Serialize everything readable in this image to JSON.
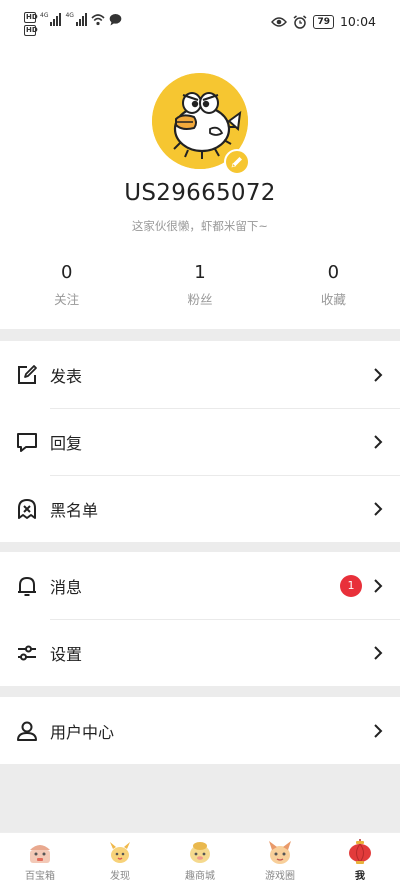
{
  "status_bar": {
    "hd1": "HD",
    "hd2": "HD",
    "net1": "4G",
    "net2": "4G",
    "battery": "79",
    "time": "10:04"
  },
  "profile": {
    "username": "US29665072",
    "bio": "这家伙很懒，虾都米留下~",
    "stats": [
      {
        "value": "0",
        "label": "关注"
      },
      {
        "value": "1",
        "label": "粉丝"
      },
      {
        "value": "0",
        "label": "收藏"
      }
    ]
  },
  "menu": {
    "group1": [
      {
        "label": "发表",
        "icon": "edit-icon"
      },
      {
        "label": "回复",
        "icon": "comment-icon"
      },
      {
        "label": "黑名单",
        "icon": "blacklist-icon"
      }
    ],
    "group2": [
      {
        "label": "消息",
        "icon": "bell-icon",
        "badge": "1"
      },
      {
        "label": "设置",
        "icon": "settings-sliders-icon"
      }
    ],
    "group3": [
      {
        "label": "用户中心",
        "icon": "user-icon"
      }
    ]
  },
  "tabbar": [
    {
      "label": "百宝箱",
      "icon": "treasure-box-icon",
      "active": false
    },
    {
      "label": "发现",
      "icon": "discover-icon",
      "active": false
    },
    {
      "label": "趣商城",
      "icon": "shop-icon",
      "active": false
    },
    {
      "label": "游戏圈",
      "icon": "game-circle-icon",
      "active": false
    },
    {
      "label": "我",
      "icon": "me-lantern-icon",
      "active": true
    }
  ],
  "colors": {
    "accent_yellow": "#f6c631",
    "badge_red": "#e8303a",
    "background": "#ececec"
  }
}
